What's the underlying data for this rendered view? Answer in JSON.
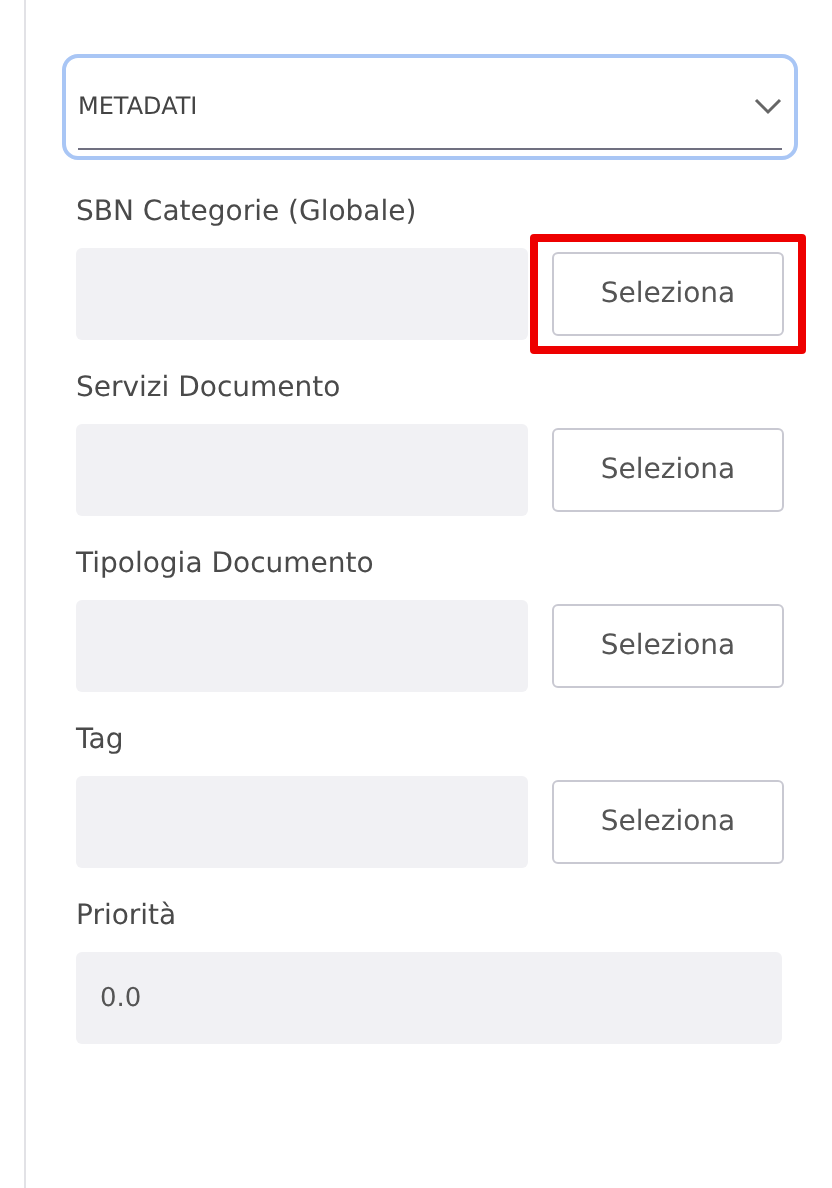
{
  "dropdown": {
    "value": "METADATI"
  },
  "fields": [
    {
      "kind": "select",
      "label": "SBN Categorie (Globale)",
      "button": "Seleziona",
      "highlighted": true
    },
    {
      "kind": "select",
      "label": "Servizi Documento",
      "button": "Seleziona",
      "highlighted": false
    },
    {
      "kind": "select",
      "label": "Tipologia Documento",
      "button": "Seleziona",
      "highlighted": false
    },
    {
      "kind": "select",
      "label": "Tag",
      "button": "Seleziona",
      "highlighted": false
    },
    {
      "kind": "number",
      "label": "Priorità",
      "value": "0.0"
    }
  ]
}
